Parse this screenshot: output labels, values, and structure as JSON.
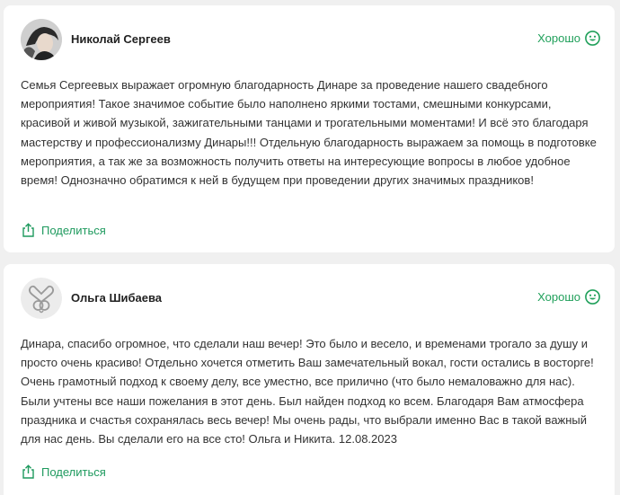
{
  "reviews": [
    {
      "author": "Николай Сергеев",
      "rating_label": "Хорошо",
      "text": "Семья Сергеевых выражает огромную благодарность Динаре за проведение нашего свадебного мероприятия! Такое значимое событие было наполнено яркими тостами, смешными конкурсами, красивой и живой музыкой, зажигательными танцами и трогательными моментами! И всё это благодаря мастерству и профессионализму Динары!!! Отдельную благодарность выражаем за помощь в подготовке мероприятия, а так же за возможность получить ответы на интересующие вопросы в любое удобное время! Однозначно обратимся к ней в будущем при проведении других значимых праздников!",
      "share_label": "Поделиться"
    },
    {
      "author": "Ольга Шибаева",
      "rating_label": "Хорошо",
      "text": "Динара, спасибо огромное, что сделали наш вечер! Это было и весело, и временами трогало за душу и просто очень красиво! Отдельно хочется отметить Ваш замечательный вокал, гости остались в восторге! Очень грамотный подход к своему делу, все уместно, все прилично (что было немаловажно для нас). Были учтены все наши пожелания в этот день. Был найден подход ко всем. Благодаря Вам атмосфера праздника и счастья сохранялась весь вечер! Мы очень рады, что выбрали именно Вас в такой важный для нас день. Вы сделали его на все сто! Ольга и Никита. 12.08.2023",
      "share_label": "Поделиться"
    }
  ],
  "colors": {
    "accent": "#21a05b",
    "link": "#1e9a5e",
    "background": "#f0f0f0",
    "card": "#ffffff"
  },
  "icons": {
    "rating": "smile-icon",
    "share": "share-icon",
    "avatar_placeholder": "rings-logo-icon"
  }
}
